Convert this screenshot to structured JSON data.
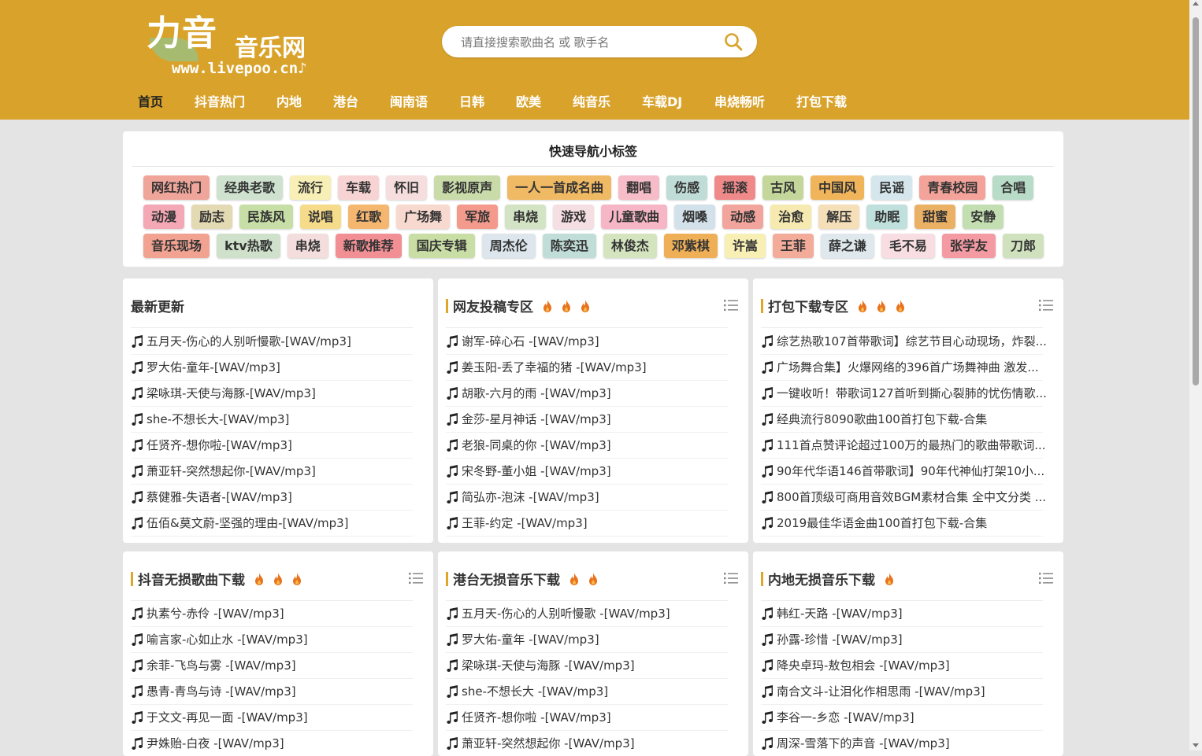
{
  "site": {
    "logo_cn": "力音",
    "logo_sub": "音乐网",
    "logo_url": "www.livepoo.cn♪"
  },
  "search": {
    "placeholder": "请直接搜索歌曲名 或 歌手名",
    "value": ""
  },
  "nav": [
    {
      "label": "首页",
      "active": true
    },
    {
      "label": "抖音热门"
    },
    {
      "label": "内地"
    },
    {
      "label": "港台"
    },
    {
      "label": "闽南语"
    },
    {
      "label": "日韩"
    },
    {
      "label": "欧美"
    },
    {
      "label": "纯音乐"
    },
    {
      "label": "车载DJ"
    },
    {
      "label": "串烧畅听"
    },
    {
      "label": "打包下载"
    }
  ],
  "quick_nav": {
    "title": "快速导航小标签",
    "rows": [
      [
        {
          "label": "网红热门",
          "color": "#f0a59a"
        },
        {
          "label": "经典老歌",
          "color": "#cfe2cf"
        },
        {
          "label": "流行",
          "color": "#f7efb5"
        },
        {
          "label": "车载",
          "color": "#f8d3d3"
        },
        {
          "label": "怀旧",
          "color": "#f7dede"
        },
        {
          "label": "影视原声",
          "color": "#c9dba9"
        },
        {
          "label": "一人一首成名曲",
          "color": "#f0b964"
        },
        {
          "label": "翻唱",
          "color": "#f6bcc8"
        },
        {
          "label": "伤感",
          "color": "#bfdcd6"
        },
        {
          "label": "摇滚",
          "color": "#f08a8a"
        },
        {
          "label": "古风",
          "color": "#c4d79b"
        },
        {
          "label": "中国风",
          "color": "#f0b45a"
        },
        {
          "label": "民谣",
          "color": "#d5e7ec"
        },
        {
          "label": "青春校园",
          "color": "#f3a39a"
        },
        {
          "label": "合唱",
          "color": "#b9dcc9"
        }
      ],
      [
        {
          "label": "动漫",
          "color": "#f4a7b5"
        },
        {
          "label": "励志",
          "color": "#e3d9b3"
        },
        {
          "label": "民族风",
          "color": "#c7dfa6"
        },
        {
          "label": "说唱",
          "color": "#f6dc8a"
        },
        {
          "label": "红歌",
          "color": "#f5b770"
        },
        {
          "label": "广场舞",
          "color": "#f8d9cf"
        },
        {
          "label": "军旅",
          "color": "#f49a8c"
        },
        {
          "label": "串烧",
          "color": "#d3e4c4"
        },
        {
          "label": "游戏",
          "color": "#f6dfe3"
        },
        {
          "label": "儿童歌曲",
          "color": "#f6b6c6"
        },
        {
          "label": "烟嗓",
          "color": "#d3e2ea"
        },
        {
          "label": "动感",
          "color": "#f2a59d"
        },
        {
          "label": "治愈",
          "color": "#f7eab1"
        },
        {
          "label": "解压",
          "color": "#f5dfb9"
        },
        {
          "label": "助眠",
          "color": "#bfe0dc"
        },
        {
          "label": "甜蜜",
          "color": "#eab064"
        },
        {
          "label": "安静",
          "color": "#c3dfb1"
        }
      ],
      [
        {
          "label": "音乐现场",
          "color": "#f2a291"
        },
        {
          "label": "ktv热歌",
          "color": "#cfe0cb"
        },
        {
          "label": "串烧",
          "color": "#f4dddd"
        },
        {
          "label": "新歌推荐",
          "color": "#f28f95"
        },
        {
          "label": "国庆专辑",
          "color": "#c8dea4"
        },
        {
          "label": "周杰伦",
          "color": "#dce6ec"
        },
        {
          "label": "陈奕迅",
          "color": "#c0ddd8"
        },
        {
          "label": "林俊杰",
          "color": "#d3e4bf"
        },
        {
          "label": "邓紫棋",
          "color": "#eeaf57"
        },
        {
          "label": "许嵩",
          "color": "#f8efb5"
        },
        {
          "label": "王菲",
          "color": "#f3ab9a"
        },
        {
          "label": "薛之谦",
          "color": "#dfe8ec"
        },
        {
          "label": "毛不易",
          "color": "#f8dde2"
        },
        {
          "label": "张学友",
          "color": "#f39aa3"
        },
        {
          "label": "刀郎",
          "color": "#cfe2bd"
        }
      ]
    ]
  },
  "sections": [
    {
      "title": "最新更新",
      "flames": 0,
      "has_bar": false,
      "has_menu": false,
      "items": [
        "五月天-伤心的人别听慢歌-[WAV/mp3]",
        "罗大佑-童年-[WAV/mp3]",
        "梁咏琪-天使与海豚-[WAV/mp3]",
        "she-不想长大-[WAV/mp3]",
        "任贤齐-想你啦-[WAV/mp3]",
        "萧亚轩-突然想起你-[WAV/mp3]",
        "蔡健雅-失语者-[WAV/mp3]",
        "伍佰&莫文蔚-坚强的理由-[WAV/mp3]"
      ]
    },
    {
      "title": "网友投稿专区",
      "flames": 3,
      "has_bar": true,
      "has_menu": true,
      "items": [
        "谢军-碎心石 -[WAV/mp3]",
        "姜玉阳-丢了幸福的猪 -[WAV/mp3]",
        "胡歌-六月的雨 -[WAV/mp3]",
        "金莎-星月神话 -[WAV/mp3]",
        "老狼-同桌的你 -[WAV/mp3]",
        "宋冬野-董小姐 -[WAV/mp3]",
        "简弘亦-泡沫 -[WAV/mp3]",
        "王菲-约定 -[WAV/mp3]"
      ]
    },
    {
      "title": "打包下载专区",
      "flames": 3,
      "has_bar": true,
      "has_menu": true,
      "items": [
        "综艺热歌107首带歌词】综艺节目心动现场，炸裂...",
        "广场舞合集】火爆网络的396首广场舞神曲 激发...",
        "一键收听！带歌词127首听到撕心裂肺的忧伤情歌...",
        "经典流行8090歌曲100首打包下载-合集",
        "111首点赞评论超过100万的最热门的歌曲带歌词...",
        "90年代华语146首带歌词】90年代神仙打架10小...",
        "800首顶级可商用音效BGM素材合集 全中文分类 ...",
        "2019最佳华语金曲100首打包下载-合集"
      ]
    },
    {
      "title": "抖音无损歌曲下载",
      "flames": 3,
      "has_bar": true,
      "has_menu": true,
      "items": [
        "执素兮-赤伶 -[WAV/mp3]",
        "喻言家-心如止水 -[WAV/mp3]",
        "余菲-飞鸟与雾 -[WAV/mp3]",
        "愚青-青鸟与诗 -[WAV/mp3]",
        "于文文-再见一面 -[WAV/mp3]",
        "尹姝贻-白夜 -[WAV/mp3]"
      ]
    },
    {
      "title": "港台无损音乐下载",
      "flames": 2,
      "has_bar": true,
      "has_menu": true,
      "items": [
        "五月天-伤心的人别听慢歌 -[WAV/mp3]",
        "罗大佑-童年 -[WAV/mp3]",
        "梁咏琪-天使与海豚 -[WAV/mp3]",
        "she-不想长大 -[WAV/mp3]",
        "任贤齐-想你啦 -[WAV/mp3]",
        "萧亚轩-突然想起你 -[WAV/mp3]"
      ]
    },
    {
      "title": "内地无损音乐下载",
      "flames": 1,
      "has_bar": true,
      "has_menu": true,
      "items": [
        "韩红-天路 -[WAV/mp3]",
        "孙露-珍惜 -[WAV/mp3]",
        "降央卓玛-敖包相会 -[WAV/mp3]",
        "南合文斗-让泪化作相思雨 -[WAV/mp3]",
        "李谷一-乡恋 -[WAV/mp3]",
        "周深-雪落下的声音 -[WAV/mp3]"
      ]
    }
  ],
  "colors": {
    "header_bg": "#d9a32b",
    "page_bg": "#e4e4e4",
    "accent_bar": "#e0a52a",
    "flame": "#e8731e"
  },
  "icons": {
    "search": "search-icon",
    "flame": "flame-icon",
    "menu": "list-menu-icon",
    "note": "music-note-icon"
  }
}
